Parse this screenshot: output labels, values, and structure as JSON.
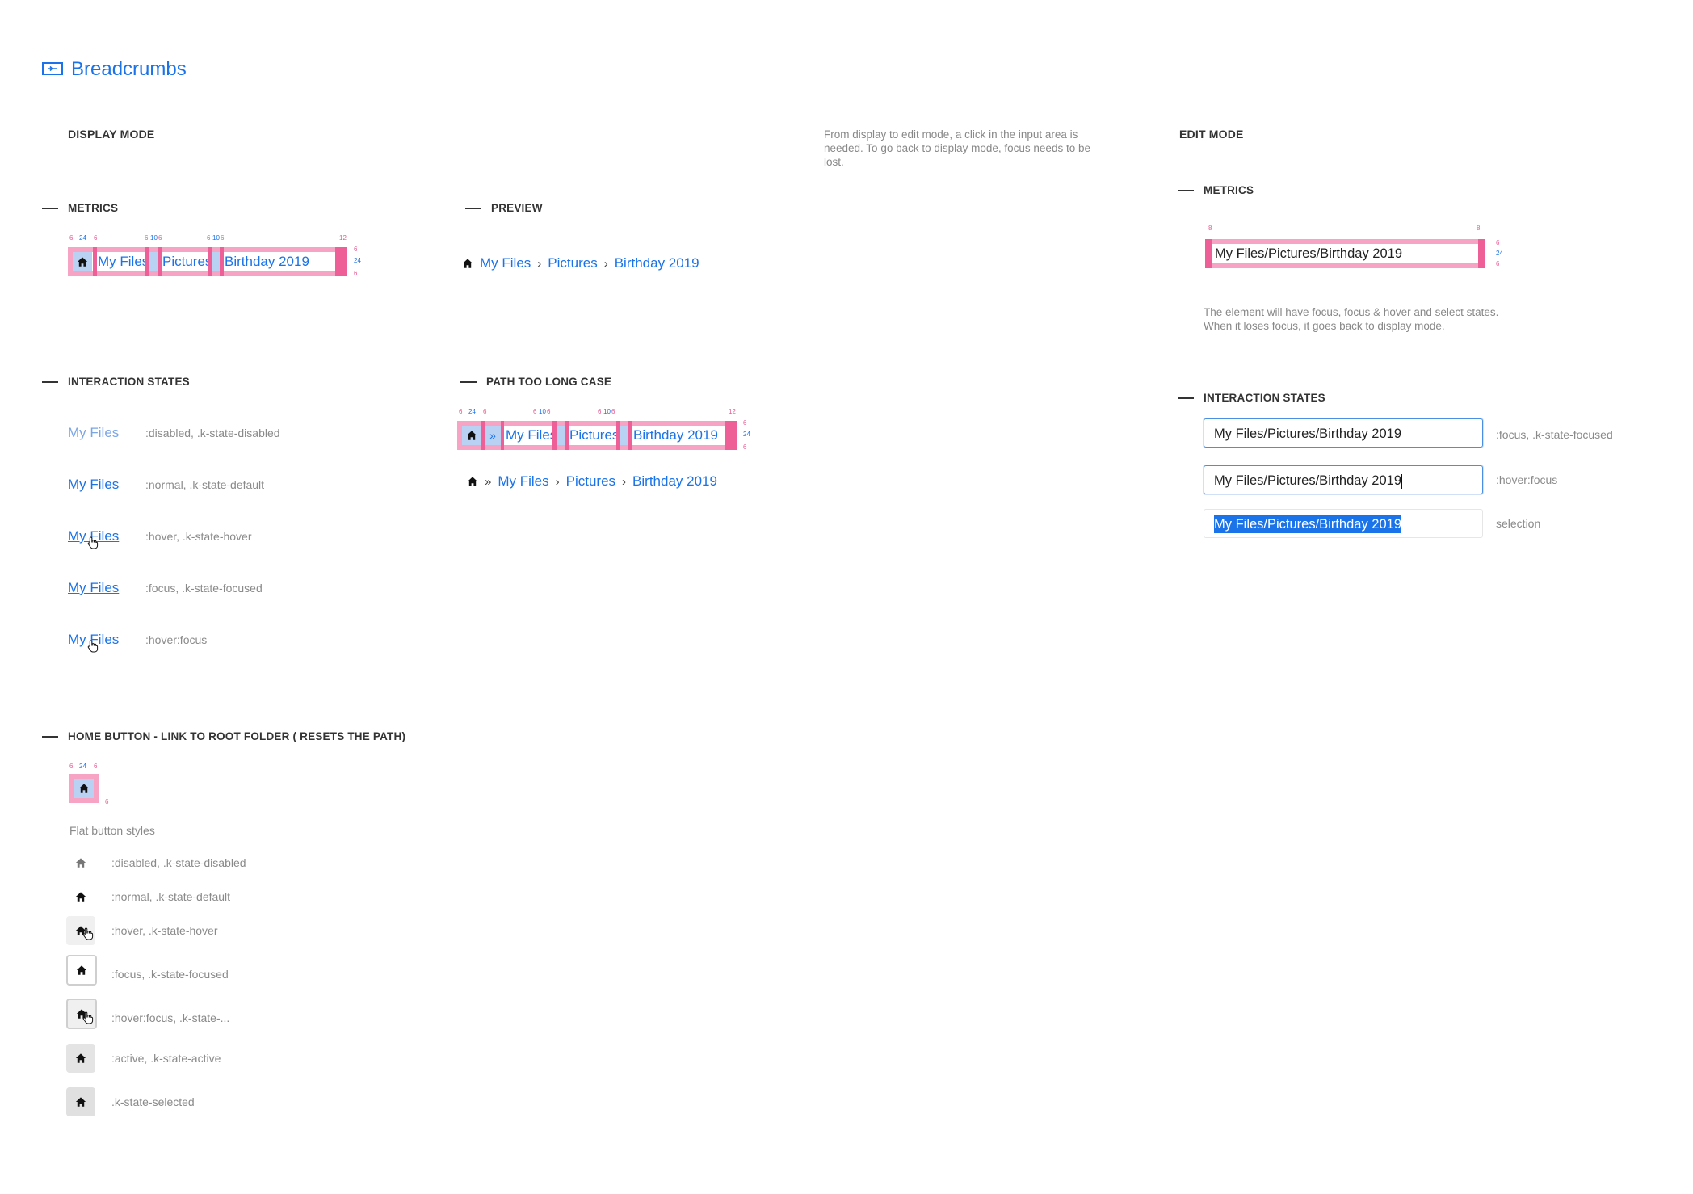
{
  "page": {
    "title": "Breadcrumbs"
  },
  "display_mode": {
    "heading": "DISPLAY MODE",
    "note": "From display to edit mode, a click in the input area is needed. To go back to display mode, focus needs to be lost.",
    "metrics": {
      "heading": "METRICS",
      "labels_pink": [
        "6",
        "6",
        "6",
        "6",
        "6",
        "6",
        "12",
        "6",
        "6"
      ],
      "labels_blue": [
        "24",
        "10",
        "10",
        "24"
      ],
      "items": [
        "My Files",
        "Pictures",
        "Birthday 2019"
      ]
    },
    "preview": {
      "heading": "PREVIEW",
      "items": [
        "My Files",
        "Pictures",
        "Birthday 2019"
      ]
    },
    "interaction_states": {
      "heading": "INTERACTION STATES",
      "states": [
        {
          "link": "My Files",
          "desc": ":disabled, .k-state-disabled"
        },
        {
          "link": "My Files",
          "desc": ":normal, .k-state-default"
        },
        {
          "link": "My Files",
          "desc": ":hover, .k-state-hover"
        },
        {
          "link": "My Files",
          "desc": ":focus, .k-state-focused"
        },
        {
          "link": "My Files",
          "desc": ":hover:focus"
        }
      ]
    },
    "path_too_long": {
      "heading": "PATH TOO LONG CASE",
      "ellipsis": "»",
      "items": [
        "My Files",
        "Pictures",
        "Birthday 2019"
      ],
      "labels_pink": [
        "6",
        "6",
        "6",
        "6",
        "6",
        "6",
        "12",
        "6",
        "6"
      ],
      "labels_blue": [
        "24",
        "10",
        "10",
        "24"
      ]
    },
    "home_button": {
      "heading": "HOME BUTTON -  LINK TO ROOT FOLDER ( RESETS THE PATH)",
      "labels_pink": [
        "6",
        "6",
        "6"
      ],
      "labels_blue": [
        "24"
      ],
      "flat_label": "Flat button styles",
      "states": [
        ":disabled, .k-state-disabled",
        ":normal, .k-state-default",
        ":hover, .k-state-hover",
        ":focus, .k-state-focused",
        ":hover:focus, .k-state-...",
        ":active, .k-state-active",
        ".k-state-selected"
      ]
    }
  },
  "edit_mode": {
    "heading": "EDIT MODE",
    "metrics": {
      "heading": "METRICS",
      "value": "My Files/Pictures/Birthday 2019",
      "labels_pink": [
        "8",
        "8",
        "6",
        "6"
      ],
      "labels_blue": [
        "24"
      ]
    },
    "note": "The element will have focus, focus & hover and select states. When it loses focus, it goes back to display mode.",
    "interaction_states": {
      "heading": "INTERACTION STATES",
      "states": [
        {
          "value": "My Files/Pictures/Birthday 2019",
          "desc": ":focus, .k-state-focused"
        },
        {
          "value": "My Files/Pictures/Birthday 2019",
          "desc": ":hover:focus"
        },
        {
          "value": "My Files/Pictures/Birthday 2019",
          "desc": "selection"
        }
      ]
    }
  },
  "colors": {
    "accent": "#1a73e8",
    "metric_pink": "#f6a3c4",
    "metric_blue": "#b9d1f2"
  },
  "icons": {
    "home": "home-icon",
    "chevron": "chevron-right-icon",
    "cursor": "hand-cursor-icon",
    "breadcrumb": "breadcrumb-icon"
  }
}
